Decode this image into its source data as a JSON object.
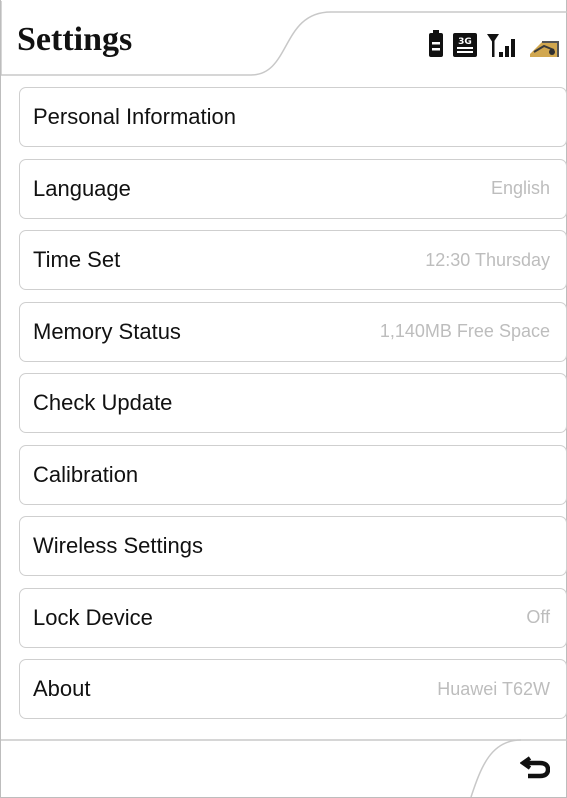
{
  "header": {
    "title": "Settings",
    "status_icons": [
      "battery-icon",
      "3g-icon",
      "signal-strength-icon",
      "wifi-icon"
    ],
    "network_badge": "3G"
  },
  "settings": {
    "items": [
      {
        "label": "Personal Information",
        "value": ""
      },
      {
        "label": "Language",
        "value": "English"
      },
      {
        "label": "Time Set",
        "value": "12:30 Thursday"
      },
      {
        "label": "Memory Status",
        "value": "1,140MB Free Space"
      },
      {
        "label": "Check Update",
        "value": ""
      },
      {
        "label": "Calibration",
        "value": ""
      },
      {
        "label": "Wireless Settings",
        "value": ""
      },
      {
        "label": "Lock Device",
        "value": "Off"
      },
      {
        "label": "About",
        "value": "Huawei T62W"
      }
    ]
  },
  "footer": {
    "back_icon": "back-arrow-icon"
  },
  "colors": {
    "text": "#111111",
    "secondary_text": "#bdbdbd",
    "border": "#cfcfcf"
  }
}
